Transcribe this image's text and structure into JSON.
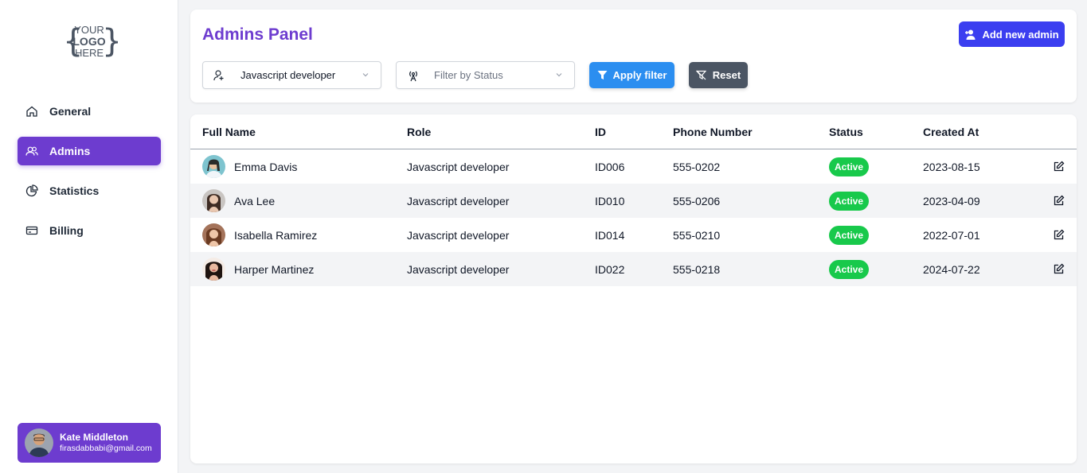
{
  "brand": {
    "logo_line1": "YOUR",
    "logo_line2": "LOGO",
    "logo_line3": "HERE"
  },
  "sidebar": {
    "items": [
      {
        "label": "General",
        "icon": "home-icon",
        "active": false
      },
      {
        "label": "Admins",
        "icon": "users-icon",
        "active": true
      },
      {
        "label": "Statistics",
        "icon": "pie-chart-icon",
        "active": false
      },
      {
        "label": "Billing",
        "icon": "credit-card-icon",
        "active": false
      }
    ],
    "profile": {
      "name": "Kate Middleton",
      "email": "firasdabbabi@gmail.com"
    }
  },
  "header": {
    "title": "Admins Panel",
    "add_button": "Add new admin",
    "role_filter": {
      "value": "Javascript developer"
    },
    "status_filter": {
      "placeholder": "Filter by Status"
    },
    "apply_button": "Apply filter",
    "reset_button": "Reset"
  },
  "table": {
    "columns": [
      "Full Name",
      "Role",
      "ID",
      "Phone Number",
      "Status",
      "Created At"
    ],
    "rows": [
      {
        "name": "Emma Davis",
        "role": "Javascript developer",
        "id": "ID006",
        "phone": "555-0202",
        "status": "Active",
        "created": "2023-08-15"
      },
      {
        "name": "Ava Lee",
        "role": "Javascript developer",
        "id": "ID010",
        "phone": "555-0206",
        "status": "Active",
        "created": "2023-04-09"
      },
      {
        "name": "Isabella Ramirez",
        "role": "Javascript developer",
        "id": "ID014",
        "phone": "555-0210",
        "status": "Active",
        "created": "2022-07-01"
      },
      {
        "name": "Harper Martinez",
        "role": "Javascript developer",
        "id": "ID022",
        "phone": "555-0218",
        "status": "Active",
        "created": "2024-07-22"
      }
    ]
  },
  "colors": {
    "accent": "#6d3ccf",
    "primary": "#3b3ef0",
    "apply": "#2b8ef0",
    "reset": "#4b5563",
    "active_badge": "#18c94b"
  }
}
